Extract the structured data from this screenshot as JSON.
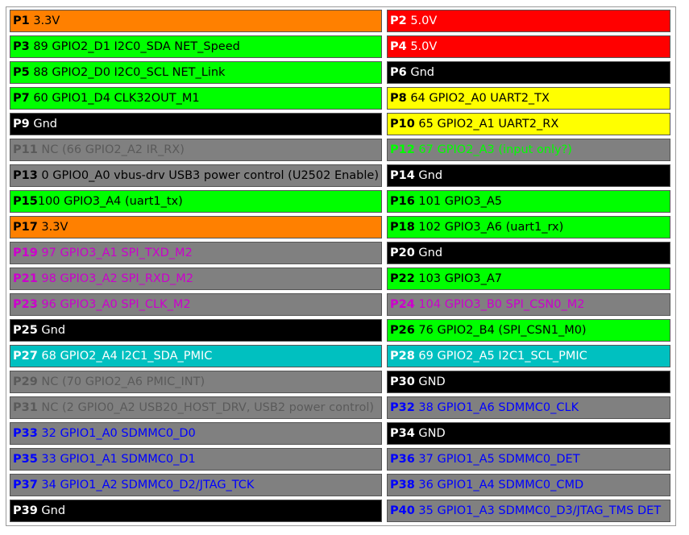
{
  "header_table": {
    "rows": [
      [
        {
          "pin": "P1",
          "label": " 3.3V",
          "bg": "#ff8000",
          "fg": "#000000"
        },
        {
          "pin": "P2",
          "label": " 5.0V",
          "bg": "#ff0000",
          "fg": "#ffffff"
        }
      ],
      [
        {
          "pin": "P3",
          "label": " 89 GPIO2_D1 I2C0_SDA NET_Speed",
          "bg": "#00ff00",
          "fg": "#000000"
        },
        {
          "pin": "P4",
          "label": " 5.0V",
          "bg": "#ff0000",
          "fg": "#ffffff"
        }
      ],
      [
        {
          "pin": "P5",
          "label": " 88 GPIO2_D0 I2C0_SCL NET_Link",
          "bg": "#00ff00",
          "fg": "#000000"
        },
        {
          "pin": "P6",
          "label": " Gnd",
          "bg": "#000000",
          "fg": "#ffffff"
        }
      ],
      [
        {
          "pin": "P7",
          "label": " 60 GPIO1_D4 CLK32OUT_M1",
          "bg": "#00ff00",
          "fg": "#000000"
        },
        {
          "pin": "P8",
          "label": " 64 GPIO2_A0 UART2_TX",
          "bg": "#ffff00",
          "fg": "#000000"
        }
      ],
      [
        {
          "pin": "P9",
          "label": " Gnd",
          "bg": "#000000",
          "fg": "#ffffff"
        },
        {
          "pin": "P10",
          "label": " 65 GPIO2_A1 UART2_RX",
          "bg": "#ffff00",
          "fg": "#000000"
        }
      ],
      [
        {
          "pin": "P11",
          "label": " NC (66 GPIO2_A2 IR_RX)",
          "bg": "#808080",
          "fg": "#5a5a5a"
        },
        {
          "pin": "P12",
          "label": " 67 GPIO2_A3 (input only?)",
          "bg": "#808080",
          "fg": "#00ff00"
        }
      ],
      [
        {
          "pin": "P13",
          "label": " 0 GPIO0_A0 vbus-drv USB3 power control (U2502 Enable)",
          "bg": "#808080",
          "fg": "#000000"
        },
        {
          "pin": "P14",
          "label": " Gnd",
          "bg": "#000000",
          "fg": "#ffffff"
        }
      ],
      [
        {
          "pin": "P15",
          "label": "100 GPIO3_A4 (uart1_tx)",
          "bg": "#00ff00",
          "fg": "#000000"
        },
        {
          "pin": "P16",
          "label": " 101 GPIO3_A5",
          "bg": "#00ff00",
          "fg": "#000000"
        }
      ],
      [
        {
          "pin": "P17",
          "label": " 3.3V",
          "bg": "#ff8000",
          "fg": "#000000"
        },
        {
          "pin": "P18",
          "label": " 102 GPIO3_A6 (uart1_rx)",
          "bg": "#00ff00",
          "fg": "#000000"
        }
      ],
      [
        {
          "pin": "P19",
          "label": " 97 GPIO3_A1 SPI_TXD_M2",
          "bg": "#808080",
          "fg": "#cc00cc"
        },
        {
          "pin": "P20",
          "label": " Gnd",
          "bg": "#000000",
          "fg": "#ffffff"
        }
      ],
      [
        {
          "pin": "P21",
          "label": " 98 GPIO3_A2 SPI_RXD_M2",
          "bg": "#808080",
          "fg": "#cc00cc"
        },
        {
          "pin": "P22",
          "label": " 103 GPIO3_A7",
          "bg": "#00ff00",
          "fg": "#000000"
        }
      ],
      [
        {
          "pin": "P23",
          "label": " 96 GPIO3_A0 SPI_CLK_M2",
          "bg": "#808080",
          "fg": "#cc00cc"
        },
        {
          "pin": "P24",
          "label": " 104 GPIO3_B0 SPI_CSN0_M2",
          "bg": "#808080",
          "fg": "#cc00cc"
        }
      ],
      [
        {
          "pin": "P25",
          "label": " Gnd",
          "bg": "#000000",
          "fg": "#ffffff"
        },
        {
          "pin": "P26",
          "label": " 76 GPIO2_B4 (SPI_CSN1_M0)",
          "bg": "#00ff00",
          "fg": "#000000"
        }
      ],
      [
        {
          "pin": "P27",
          "label": " 68 GPIO2_A4 I2C1_SDA_PMIC",
          "bg": "#00c0c0",
          "fg": "#ffffff"
        },
        {
          "pin": "P28",
          "label": " 69 GPIO2_A5 I2C1_SCL_PMIC",
          "bg": "#00c0c0",
          "fg": "#ffffff"
        }
      ],
      [
        {
          "pin": "P29",
          "label": " NC (70 GPIO2_A6 PMIC_INT)",
          "bg": "#808080",
          "fg": "#5a5a5a"
        },
        {
          "pin": "P30",
          "label": " GND",
          "bg": "#000000",
          "fg": "#ffffff"
        }
      ],
      [
        {
          "pin": "P31",
          "label": " NC (2 GPIO0_A2 USB20_HOST_DRV, USB2 power control)",
          "bg": "#808080",
          "fg": "#5a5a5a"
        },
        {
          "pin": "P32",
          "label": " 38 GPIO1_A6 SDMMC0_CLK",
          "bg": "#808080",
          "fg": "#0000ff"
        }
      ],
      [
        {
          "pin": "P33",
          "label": " 32 GPIO1_A0 SDMMC0_D0",
          "bg": "#808080",
          "fg": "#0000ff"
        },
        {
          "pin": "P34",
          "label": " GND",
          "bg": "#000000",
          "fg": "#ffffff"
        }
      ],
      [
        {
          "pin": "P35",
          "label": " 33 GPIO1_A1 SDMMC0_D1",
          "bg": "#808080",
          "fg": "#0000ff"
        },
        {
          "pin": "P36",
          "label": " 37 GPIO1_A5 SDMMC0_DET",
          "bg": "#808080",
          "fg": "#0000ff"
        }
      ],
      [
        {
          "pin": "P37",
          "label": " 34 GPIO1_A2 SDMMC0_D2/JTAG_TCK",
          "bg": "#808080",
          "fg": "#0000ff"
        },
        {
          "pin": "P38",
          "label": " 36 GPIO1_A4 SDMMC0_CMD",
          "bg": "#808080",
          "fg": "#0000ff"
        }
      ],
      [
        {
          "pin": "P39",
          "label": " Gnd",
          "bg": "#000000",
          "fg": "#ffffff"
        },
        {
          "pin": "P40",
          "label": " 35 GPIO1_A3 SDMMC0_D3/JTAG_TMS DET",
          "bg": "#808080",
          "fg": "#0000ff"
        }
      ]
    ]
  }
}
